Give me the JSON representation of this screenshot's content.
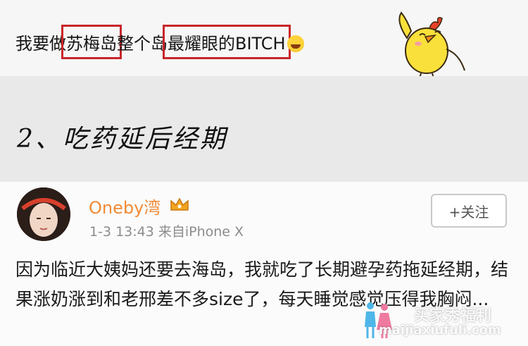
{
  "caption": {
    "part1": "我要做",
    "highlight1": "苏梅岛",
    "part2": "整个岛",
    "highlight2": "最耀眼的BITCH"
  },
  "section_title": "2、吃药延后经期",
  "post": {
    "username": "Oneby湾",
    "meta": "1-3 13:43  来自iPhone X",
    "follow_label": "+关注",
    "body": "因为临近大姨妈还要去海岛，我就吃了长期避孕药拖延经期，结果涨奶涨到和老邢差不多size了，每天睡觉感觉压得我胸闷..."
  },
  "watermark": {
    "cn": "买家秀福利",
    "url": "maijiaxiufuli.com"
  },
  "colors": {
    "highlight_box": "#c8262c",
    "username": "#f08a35",
    "meta": "#8c8c8c"
  },
  "icons": [
    "laughing-emoji-icon",
    "chick-sticker-icon",
    "crown-icon",
    "watermark-figures-icon"
  ]
}
